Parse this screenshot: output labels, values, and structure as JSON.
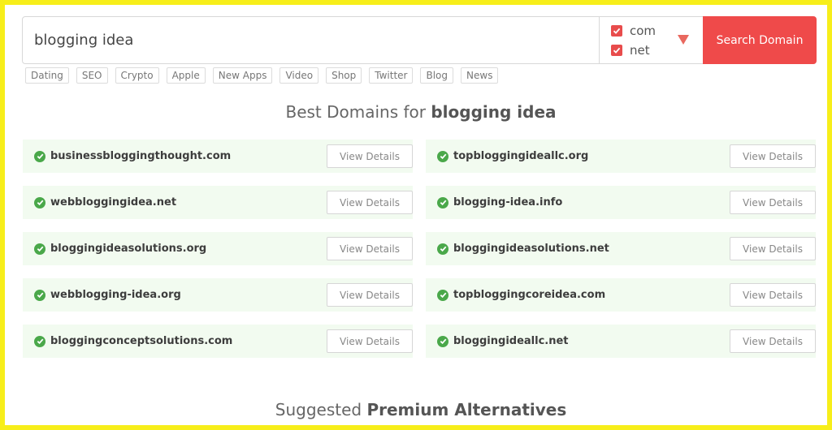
{
  "search": {
    "value": "blogging idea",
    "button_label": "Search Domain",
    "tlds": [
      {
        "label": "com",
        "checked": true
      },
      {
        "label": "net",
        "checked": true
      }
    ]
  },
  "tags": [
    "Dating",
    "SEO",
    "Crypto",
    "Apple",
    "New Apps",
    "Video",
    "Shop",
    "Twitter",
    "Blog",
    "News"
  ],
  "best_heading": {
    "prefix": "Best Domains for ",
    "keyword": "blogging idea"
  },
  "results": [
    {
      "domain": "businessbloggingthought.com",
      "action": "View Details"
    },
    {
      "domain": "topbloggingideallc.org",
      "action": "View Details"
    },
    {
      "domain": "webbloggingidea.net",
      "action": "View Details"
    },
    {
      "domain": "blogging-idea.info",
      "action": "View Details"
    },
    {
      "domain": "bloggingideasolutions.org",
      "action": "View Details"
    },
    {
      "domain": "bloggingideasolutions.net",
      "action": "View Details"
    },
    {
      "domain": "webblogging-idea.org",
      "action": "View Details"
    },
    {
      "domain": "topbloggingcoreidea.com",
      "action": "View Details"
    },
    {
      "domain": "bloggingconceptsolutions.com",
      "action": "View Details"
    },
    {
      "domain": "bloggingideallc.net",
      "action": "View Details"
    }
  ],
  "premium_heading": {
    "prefix": "Suggested ",
    "emphasis": "Premium Alternatives"
  },
  "colors": {
    "accent": "#ef4a4a",
    "success": "#4aa84a",
    "frame": "#f7ee1a",
    "result_bg": "#f2fbf0"
  }
}
